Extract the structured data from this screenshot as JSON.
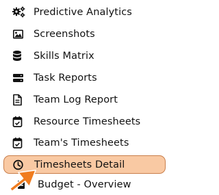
{
  "menu": {
    "items": [
      {
        "label": "Predictive Analytics",
        "icon": "gears-icon"
      },
      {
        "label": "Screenshots",
        "icon": "image-icon"
      },
      {
        "label": "Skills Matrix",
        "icon": "database-icon"
      },
      {
        "label": "Task Reports",
        "icon": "server-icon"
      },
      {
        "label": "Team Log Report",
        "icon": "document-icon"
      },
      {
        "label": "Resource Timesheets",
        "icon": "calendar-check-icon"
      },
      {
        "label": "Team's Timesheets",
        "icon": "calendar-check-icon"
      },
      {
        "label": "Timesheets Detail",
        "icon": "clock-icon",
        "active": true
      },
      {
        "label": "Budget - Overview",
        "icon": "budget-icon"
      }
    ]
  },
  "colors": {
    "active_background": "#f9c9a3",
    "active_border": "#c97f4c",
    "pointer_arrow": "#f07c1f",
    "text": "#111111"
  }
}
